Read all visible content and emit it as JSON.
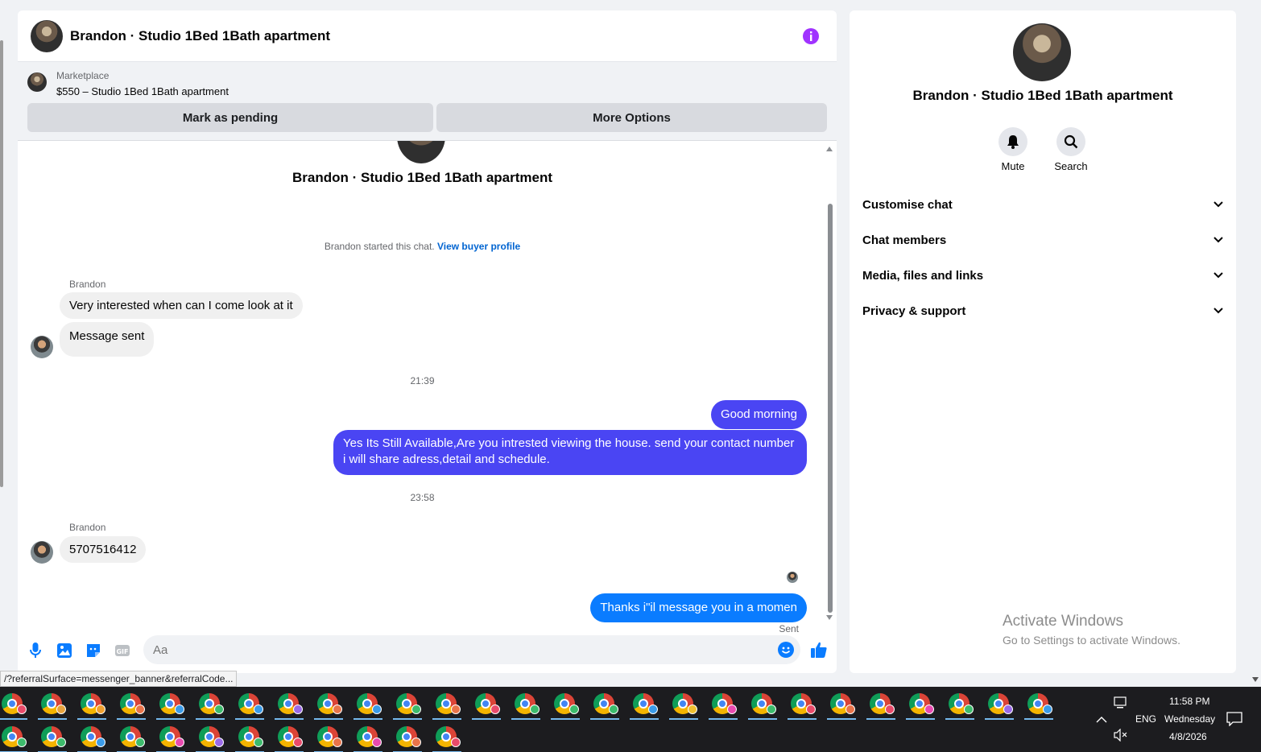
{
  "chat": {
    "title": "Brandon · Studio 1Bed 1Bath apartment",
    "marketplace_label": "Marketplace",
    "listing": "$550 – Studio 1Bed 1Bath apartment",
    "btn_pending": "Mark as pending",
    "btn_more": "More Options",
    "conversation_title": "Brandon · Studio 1Bed 1Bath apartment",
    "started_text": "Brandon started this chat.",
    "started_link": "View buyer profile",
    "messages": [
      {
        "sender": "Brandon",
        "text": "Very interested when can I come look at it"
      },
      {
        "text": "Message sent"
      },
      {
        "time": "21:39"
      },
      {
        "text": "Good morning"
      },
      {
        "text": "Yes Its Still Available,Are you intrested viewing the house. send your contact number i will share adress,detail and schedule."
      },
      {
        "time": "23:58"
      },
      {
        "sender": "Brandon",
        "text": "5707516412"
      },
      {
        "text": "Thanks i\"il message you in a momen"
      },
      {
        "status": "Sent"
      }
    ],
    "composer_placeholder": "Aa"
  },
  "url_tooltip": "/?referralSurface=messenger_banner&referralCode...",
  "info_panel": {
    "title": "Brandon · Studio 1Bed 1Bath apartment",
    "mute_label": "Mute",
    "search_label": "Search",
    "sections": [
      "Customise chat",
      "Chat members",
      "Media, files and links",
      "Privacy & support"
    ]
  },
  "watermark": {
    "line1": "Activate Windows",
    "line2": "Go to Settings to activate Windows."
  },
  "taskbar": {
    "language": "ENG",
    "time": "11:58 PM",
    "day": "Wednesday",
    "date": "4/8/2026",
    "badge_colors": [
      "#e94b6a",
      "#e8a33d",
      "#f0a030",
      "#e8744a",
      "#3b9be8",
      "#3dbb6c",
      "#3b9be8",
      "#9b6be8",
      "#e8744a",
      "#3b9be8",
      "#3dbb6c",
      "#e8744a",
      "#e94b6a",
      "#3dbb6c",
      "#3dbb6c",
      "#3dbb6c",
      "#3b9be8",
      "#f0c030",
      "#e94bb0",
      "#3dbb6c",
      "#e94b6a",
      "#e8744a",
      "#e94b6a",
      "#e94bb0",
      "#3dbb6c",
      "#9b6be8",
      "#3b9be8",
      "#3dbb6c",
      "#3dbb6c",
      "#3b9be8",
      "#3dbb6c",
      "#e94bb0",
      "#9b6be8",
      "#3dbb6c",
      "#e94b6a",
      "#e8744a",
      "#e94bb0",
      "#e8744a",
      "#e94b6a"
    ]
  },
  "colors": {
    "outgoing_purple": "#4a45f3",
    "outgoing_blue": "#0a7cff",
    "link_blue": "#0064d1",
    "info_purple": "#a033ff"
  }
}
